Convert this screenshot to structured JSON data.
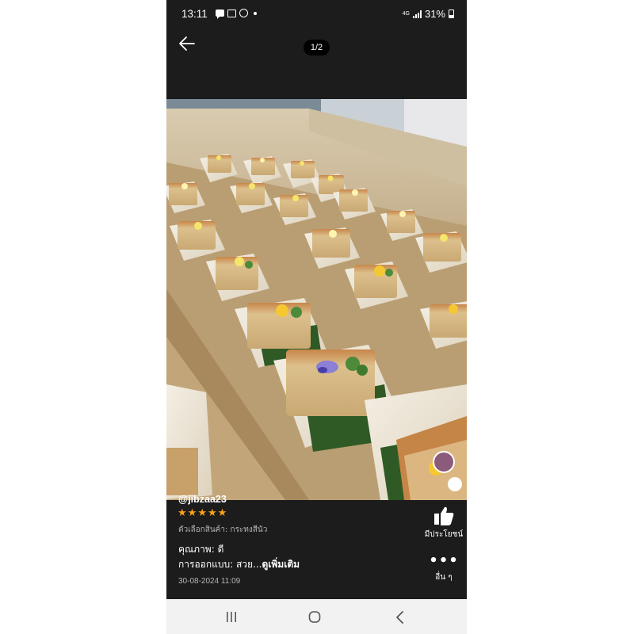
{
  "status_bar": {
    "time": "13:11",
    "network_type": "4G",
    "battery": "31%"
  },
  "viewer": {
    "page_counter": "1/2"
  },
  "review": {
    "username": "@jibzaa23",
    "rating": 5,
    "stars": [
      "★",
      "★",
      "★",
      "★",
      "★"
    ],
    "variant": "ตัวเลือกสินค้า: กระทงสีนัว",
    "quality": "คุณภาพ: ดี",
    "design_prefix": "การออกแบบ: สวย...",
    "see_more": "ดูเพิ่มเติม",
    "date": "30-08-2024 11:09",
    "like_label": "มีประโยชน์",
    "more_label": "อื่น ๆ"
  },
  "colors": {
    "background": "#1c1c1c",
    "star": "#f6a21a",
    "navbar": "#f2f2f2"
  },
  "icons": {
    "back": "arrow-left-icon",
    "like": "thumbs-up-icon",
    "more": "more-dots-icon",
    "nav_recent": "recent-apps-icon",
    "nav_home": "home-icon",
    "nav_back": "chevron-left-icon"
  }
}
